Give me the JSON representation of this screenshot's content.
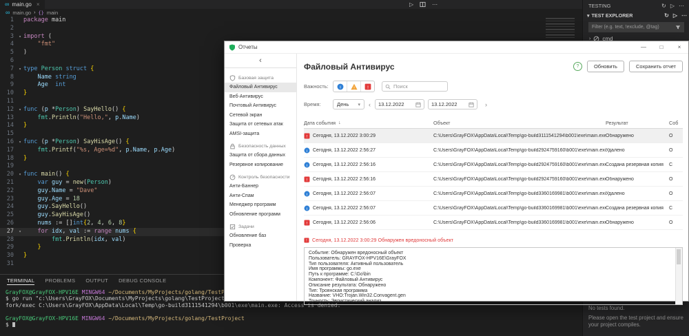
{
  "icons": {
    "infinity": "∞",
    "chevron_right": "›",
    "caret_down": "▾",
    "play": "▷",
    "more": "⋯",
    "refresh": "↻",
    "close": "×",
    "minimize": "—",
    "maximize": "□",
    "back": "‹",
    "prev": "‹",
    "next": "›",
    "sort_down": "↓",
    "braces": "{}"
  },
  "vscode": {
    "tab_label": "main.go",
    "breadcrumb": {
      "file": "main.go",
      "symbol": "main"
    },
    "panel_tabs": [
      "TERMINAL",
      "PROBLEMS",
      "OUTPUT",
      "DEBUG CONSOLE"
    ],
    "code": {
      "active_line": 27,
      "lines": [
        {
          "n": 1,
          "t": [
            [
              "kp",
              "package"
            ],
            [
              "df",
              " main"
            ]
          ]
        },
        {
          "n": 2,
          "t": []
        },
        {
          "n": 3,
          "fold": true,
          "t": [
            [
              "kp",
              "import"
            ],
            [
              "df",
              " ("
            ]
          ]
        },
        {
          "n": 4,
          "t": [
            [
              "df",
              "    "
            ],
            [
              "st",
              "\"fmt\""
            ]
          ]
        },
        {
          "n": 5,
          "t": [
            [
              "df",
              ")"
            ]
          ]
        },
        {
          "n": 6,
          "t": []
        },
        {
          "n": 7,
          "fold": true,
          "t": [
            [
              "kb",
              "type"
            ],
            [
              "df",
              " "
            ],
            [
              "ty",
              "Person"
            ],
            [
              "df",
              " "
            ],
            [
              "kb",
              "struct"
            ],
            [
              "br",
              " {"
            ]
          ]
        },
        {
          "n": 8,
          "t": [
            [
              "df",
              "    "
            ],
            [
              "vr",
              "Name"
            ],
            [
              "df",
              " "
            ],
            [
              "kb",
              "string"
            ]
          ]
        },
        {
          "n": 9,
          "t": [
            [
              "df",
              "    "
            ],
            [
              "vr",
              "Age"
            ],
            [
              "df",
              "  "
            ],
            [
              "kb",
              "int"
            ]
          ]
        },
        {
          "n": 10,
          "t": [
            [
              "br",
              "}"
            ]
          ]
        },
        {
          "n": 11,
          "t": []
        },
        {
          "n": 12,
          "fold": true,
          "t": [
            [
              "kb",
              "func"
            ],
            [
              "df",
              " ("
            ],
            [
              "vr",
              "p"
            ],
            [
              "df",
              " *"
            ],
            [
              "ty",
              "Person"
            ],
            [
              "df",
              ") "
            ],
            [
              "fn",
              "SayHello"
            ],
            [
              "df",
              "() "
            ],
            [
              "br",
              "{"
            ]
          ]
        },
        {
          "n": 13,
          "t": [
            [
              "df",
              "    "
            ],
            [
              "ty",
              "fmt"
            ],
            [
              "df",
              "."
            ],
            [
              "fn",
              "Println"
            ],
            [
              "df",
              "("
            ],
            [
              "st",
              "\"Hello,\""
            ],
            [
              "df",
              ", "
            ],
            [
              "vr",
              "p"
            ],
            [
              "df",
              "."
            ],
            [
              "vr",
              "Name"
            ],
            [
              "df",
              ")"
            ]
          ]
        },
        {
          "n": 14,
          "t": [
            [
              "br",
              "}"
            ]
          ]
        },
        {
          "n": 15,
          "t": []
        },
        {
          "n": 16,
          "fold": true,
          "t": [
            [
              "kb",
              "func"
            ],
            [
              "df",
              " ("
            ],
            [
              "vr",
              "p"
            ],
            [
              "df",
              " *"
            ],
            [
              "ty",
              "Person"
            ],
            [
              "df",
              ") "
            ],
            [
              "fn",
              "SayHisAge"
            ],
            [
              "df",
              "() "
            ],
            [
              "br",
              "{"
            ]
          ]
        },
        {
          "n": 17,
          "t": [
            [
              "df",
              "    "
            ],
            [
              "ty",
              "fmt"
            ],
            [
              "df",
              "."
            ],
            [
              "fn",
              "Printf"
            ],
            [
              "df",
              "("
            ],
            [
              "st",
              "\"%s, Age=%d\""
            ],
            [
              "df",
              ", "
            ],
            [
              "vr",
              "p"
            ],
            [
              "df",
              "."
            ],
            [
              "vr",
              "Name"
            ],
            [
              "df",
              ", "
            ],
            [
              "vr",
              "p"
            ],
            [
              "df",
              "."
            ],
            [
              "vr",
              "Age"
            ],
            [
              "df",
              ")"
            ]
          ]
        },
        {
          "n": 18,
          "t": [
            [
              "br",
              "}"
            ]
          ]
        },
        {
          "n": 19,
          "t": []
        },
        {
          "n": 20,
          "fold": true,
          "t": [
            [
              "kb",
              "func"
            ],
            [
              "df",
              " "
            ],
            [
              "fn",
              "main"
            ],
            [
              "df",
              "() "
            ],
            [
              "br",
              "{"
            ]
          ]
        },
        {
          "n": 21,
          "t": [
            [
              "df",
              "    "
            ],
            [
              "kb",
              "var"
            ],
            [
              "df",
              " "
            ],
            [
              "vr",
              "guy"
            ],
            [
              "df",
              " = "
            ],
            [
              "fn",
              "new"
            ],
            [
              "df",
              "("
            ],
            [
              "ty",
              "Person"
            ],
            [
              "df",
              ")"
            ]
          ]
        },
        {
          "n": 22,
          "t": [
            [
              "df",
              "    "
            ],
            [
              "vr",
              "guy"
            ],
            [
              "df",
              "."
            ],
            [
              "vr",
              "Name"
            ],
            [
              "df",
              " = "
            ],
            [
              "st",
              "\"Dave\""
            ]
          ]
        },
        {
          "n": 23,
          "t": [
            [
              "df",
              "    "
            ],
            [
              "vr",
              "guy"
            ],
            [
              "df",
              "."
            ],
            [
              "vr",
              "Age"
            ],
            [
              "df",
              " = "
            ],
            [
              "nu",
              "18"
            ]
          ]
        },
        {
          "n": 24,
          "t": [
            [
              "df",
              "    "
            ],
            [
              "vr",
              "guy"
            ],
            [
              "df",
              "."
            ],
            [
              "fn",
              "SayHello"
            ],
            [
              "df",
              "()"
            ]
          ]
        },
        {
          "n": 25,
          "t": [
            [
              "df",
              "    "
            ],
            [
              "vr",
              "guy"
            ],
            [
              "df",
              "."
            ],
            [
              "fn",
              "SayHisAge"
            ],
            [
              "df",
              "()"
            ]
          ]
        },
        {
          "n": 26,
          "t": [
            [
              "df",
              "    "
            ],
            [
              "vr",
              "nums"
            ],
            [
              "df",
              " := []"
            ],
            [
              "kb",
              "int"
            ],
            [
              "br",
              "{"
            ],
            [
              "nu",
              "2"
            ],
            [
              "df",
              ", "
            ],
            [
              "nu",
              "4"
            ],
            [
              "df",
              ", "
            ],
            [
              "nu",
              "6"
            ],
            [
              "df",
              ", "
            ],
            [
              "nu",
              "8"
            ],
            [
              "br",
              "}"
            ]
          ]
        },
        {
          "n": 27,
          "fold": true,
          "t": [
            [
              "df",
              "    "
            ],
            [
              "kp",
              "for"
            ],
            [
              "df",
              " "
            ],
            [
              "vr",
              "idx"
            ],
            [
              "df",
              ", "
            ],
            [
              "vr",
              "val"
            ],
            [
              "df",
              " := "
            ],
            [
              "kp",
              "range"
            ],
            [
              "df",
              " "
            ],
            [
              "vr",
              "nums"
            ],
            [
              "br",
              " {"
            ]
          ]
        },
        {
          "n": 28,
          "t": [
            [
              "df",
              "        "
            ],
            [
              "ty",
              "fmt"
            ],
            [
              "df",
              "."
            ],
            [
              "fn",
              "Println"
            ],
            [
              "df",
              "("
            ],
            [
              "vr",
              "idx"
            ],
            [
              "df",
              ", "
            ],
            [
              "vr",
              "val"
            ],
            [
              "df",
              ")"
            ]
          ]
        },
        {
          "n": 29,
          "t": [
            [
              "br",
              "    }"
            ]
          ]
        },
        {
          "n": 30,
          "t": [
            [
              "br",
              "}"
            ]
          ]
        },
        {
          "n": 31,
          "t": []
        }
      ]
    },
    "terminal_lines": [
      {
        "t": [
          [
            "tg",
            "GrayFOX@GrayFOX-HPV16E "
          ],
          [
            "tp",
            "MINGW64 "
          ],
          [
            "tyw",
            "~/Documents/MyProjects/golang/TestProject"
          ]
        ]
      },
      {
        "t": [
          [
            "tw",
            "$ go run \"c:\\Users\\GrayFOX\\Documents\\MyProjects\\golang\\TestProject\\main.go\""
          ]
        ]
      },
      {
        "t": [
          [
            "tw",
            "fork/exec C:\\Users\\GrayFOX\\AppData\\Local\\Temp\\go-build3111541294\\b001\\exe\\main.exe: Access is denied."
          ]
        ]
      },
      {
        "t": []
      },
      {
        "t": [
          [
            "tg",
            "GrayFOX@GrayFOX-HPV16E "
          ],
          [
            "tp",
            "MINGW64 "
          ],
          [
            "tyw",
            "~/Documents/MyProjects/golang/TestProject"
          ]
        ]
      },
      {
        "t": [
          [
            "tw",
            "$ "
          ]
        ]
      }
    ]
  },
  "testing": {
    "title": "TESTING",
    "section": "TEST EXPLORER",
    "filter_placeholder": "Filter (e.g. text, !exclude, @tag)",
    "tree_item": "cmd",
    "empty_title": "No tests found.",
    "empty_message": "Please open the test project and ensure your project compiles."
  },
  "report": {
    "window_title": "Отчеты",
    "sidebar": {
      "selected": "Файловый Антивирус",
      "groups": [
        {
          "icon": "shield",
          "label": "Базовая защита",
          "items": [
            "Файловый Антивирус",
            "Веб-Антивирус",
            "Почтовый Антивирус",
            "Сетевой экран",
            "Защита от сетевых атак",
            "AMSI-защита"
          ]
        },
        {
          "icon": "lock",
          "label": "Безопасность данных",
          "items": [
            "Защита от сбора данных",
            "Резервное копирование"
          ]
        },
        {
          "icon": "gauge",
          "label": "Контроль безопасности",
          "items": [
            "Анти-Баннер",
            "Анти-Спам",
            "Менеджер программ",
            "Обновление программ"
          ]
        },
        {
          "icon": "tasks",
          "label": "Задачи",
          "items": [
            "Обновление баз",
            "Проверка"
          ]
        }
      ]
    },
    "main": {
      "title": "Файловый Антивирус",
      "refresh_button": "Обновить",
      "save_button": "Сохранить отчет",
      "severity_label": "Важность:",
      "severity_filters": [
        "info",
        "warning",
        "critical"
      ],
      "search_placeholder": "Поиск",
      "time_label": "Время:",
      "period_value": "День",
      "date_from": "13.12.2022",
      "date_to": "13.12.2022",
      "table": {
        "columns": [
          "Дата события",
          "Объект",
          "Результат",
          "Соб"
        ],
        "rows": [
          {
            "severity": "critical",
            "selected": true,
            "date": "Сегодня, 13.12.2022 3:00:29",
            "object": "C:\\Users\\GrayFOX\\AppData\\Local\\Temp\\go-build3111541294\\b001\\exe\\main.exe",
            "result": "Обнаружено",
            "event": "О"
          },
          {
            "severity": "info",
            "date": "Сегодня, 13.12.2022 2:56:27",
            "object": "C:\\Users\\GrayFOX\\AppData\\Local\\Temp\\go-build2924759160\\b001\\exe\\main.exe",
            "result": "Удалено",
            "event": "О"
          },
          {
            "severity": "info",
            "date": "Сегодня, 13.12.2022 2:56:16",
            "object": "C:\\Users\\GrayFOX\\AppData\\Local\\Temp\\go-build2924759160\\b001\\exe\\main.exe",
            "result": "Создана резервная копия",
            "event": "С"
          },
          {
            "severity": "critical",
            "date": "Сегодня, 13.12.2022 2:56:16",
            "object": "C:\\Users\\GrayFOX\\AppData\\Local\\Temp\\go-build2924759160\\b001\\exe\\main.exe",
            "result": "Обнаружено",
            "event": "О"
          },
          {
            "severity": "info",
            "date": "Сегодня, 13.12.2022 2:56:07",
            "object": "C:\\Users\\GrayFOX\\AppData\\Local\\Temp\\go-build3360169981\\b001\\exe\\main.exe",
            "result": "Удалено",
            "event": "О"
          },
          {
            "severity": "info",
            "date": "Сегодня, 13.12.2022 2:56:07",
            "object": "C:\\Users\\GrayFOX\\AppData\\Local\\Temp\\go-build3360169981\\b001\\exe\\main.exe",
            "result": "Создана резервная копия",
            "event": "С"
          },
          {
            "severity": "critical",
            "date": "Сегодня, 13.12.2022 2:56:06",
            "object": "C:\\Users\\GrayFOX\\AppData\\Local\\Temp\\go-build3360169981\\b001\\exe\\main.exe",
            "result": "Обнаружено",
            "event": "О"
          }
        ]
      },
      "selected_event_line": "Сегодня, 13.12.2022 3:00:29 Обнаружен вредоносный объект",
      "details": [
        "Событие: Обнаружен вредоносный объект",
        "Пользователь: GRAYFOX-HPV16E\\GrayFOX",
        "Тип пользователя: Активный пользователь",
        "Имя программы: go.exe",
        "Путь к программе: C:\\Go\\bin",
        "Компонент: Файловый Антивирус",
        "Описание результата: Обнаружено",
        "Тип: Троянская программа",
        "Название: VHO:Trojan.Win32.Convagent.gen",
        "Точность: Эвристический анализ"
      ]
    }
  }
}
